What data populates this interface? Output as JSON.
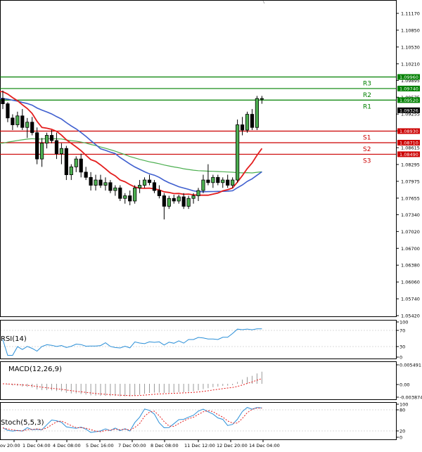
{
  "chart_data": {
    "type": "candlestick",
    "price_axis": {
      "ticks": [
        "1.11170",
        "1.10850",
        "1.10530",
        "1.10210",
        "1.09895",
        "1.09575",
        "1.09255",
        "1.08935",
        "1.08615",
        "1.08295",
        "1.07975",
        "1.07655",
        "1.07340",
        "1.07020",
        "1.06700",
        "1.06380",
        "1.06060",
        "1.05740",
        "1.05420"
      ],
      "range": [
        1.0527,
        1.1135
      ]
    },
    "time_axis": {
      "ticks": [
        "ov 20:00",
        "1 Dec 04:00",
        "4 Dec 08:00",
        "5 Dec 16:00",
        "7 Dec 00:00",
        "8 Dec 08:00",
        "11 Dec 12:00",
        "12 Dec 20:00",
        "14 Dec 04:00"
      ]
    },
    "current_price": "1.09326",
    "levels": [
      {
        "name": "R3",
        "value": 1.0996,
        "label": "1.09960",
        "color": "#008000"
      },
      {
        "name": "R2",
        "value": 1.0974,
        "label": "1.09740",
        "color": "#008000"
      },
      {
        "name": "R1",
        "value": 1.0952,
        "label": "1.09520",
        "color": "#008000"
      },
      {
        "name": "S1",
        "value": 1.0893,
        "label": "1.08930",
        "color": "#cc0000"
      },
      {
        "name": "S2",
        "value": 1.0871,
        "label": "1.08710",
        "color": "#cc0000"
      },
      {
        "name": "S3",
        "value": 1.0849,
        "label": "1.08490",
        "color": "#cc0000"
      }
    ],
    "candles": [
      [
        1.0955,
        1.097,
        1.0935,
        1.0945
      ],
      [
        1.0945,
        1.0948,
        1.091,
        1.0918
      ],
      [
        1.0918,
        1.0925,
        1.0895,
        1.0905
      ],
      [
        1.0905,
        1.093,
        1.09,
        1.0922
      ],
      [
        1.0922,
        1.0935,
        1.0895,
        1.09
      ],
      [
        1.09,
        1.0918,
        1.088,
        1.091
      ],
      [
        1.091,
        1.092,
        1.0885,
        1.089
      ],
      [
        1.089,
        1.09,
        1.083,
        1.084
      ],
      [
        1.084,
        1.088,
        1.0825,
        1.087
      ],
      [
        1.087,
        1.089,
        1.086,
        1.0885
      ],
      [
        1.0885,
        1.0895,
        1.087,
        1.0875
      ],
      [
        1.0875,
        1.089,
        1.084,
        1.085
      ],
      [
        1.085,
        1.087,
        1.083,
        1.086
      ],
      [
        1.086,
        1.0865,
        1.08,
        1.081
      ],
      [
        1.081,
        1.083,
        1.08,
        1.0825
      ],
      [
        1.0825,
        1.0845,
        1.0815,
        1.084
      ],
      [
        1.084,
        1.085,
        1.0805,
        1.0815
      ],
      [
        1.0815,
        1.0825,
        1.08,
        1.0805
      ],
      [
        1.0805,
        1.0815,
        1.078,
        1.079
      ],
      [
        1.079,
        1.081,
        1.078,
        1.08
      ],
      [
        1.08,
        1.081,
        1.0785,
        1.079
      ],
      [
        1.079,
        1.0805,
        1.078,
        1.0795
      ],
      [
        1.0795,
        1.08,
        1.0775,
        1.078
      ],
      [
        1.078,
        1.079,
        1.077,
        1.0785
      ],
      [
        1.0785,
        1.079,
        1.076,
        1.0765
      ],
      [
        1.0765,
        1.0775,
        1.0755,
        1.077
      ],
      [
        1.077,
        1.078,
        1.0752,
        1.076
      ],
      [
        1.076,
        1.079,
        1.0755,
        1.0785
      ],
      [
        1.0785,
        1.08,
        1.0775,
        1.079
      ],
      [
        1.079,
        1.0805,
        1.0785,
        1.08
      ],
      [
        1.08,
        1.081,
        1.079,
        1.0795
      ],
      [
        1.0795,
        1.08,
        1.0775,
        1.078
      ],
      [
        1.078,
        1.079,
        1.0765,
        1.077
      ],
      [
        1.077,
        1.0775,
        1.0725,
        1.075
      ],
      [
        1.075,
        1.077,
        1.0745,
        1.0765
      ],
      [
        1.0765,
        1.0772,
        1.0755,
        1.076
      ],
      [
        1.076,
        1.0772,
        1.0755,
        1.0768
      ],
      [
        1.0768,
        1.0775,
        1.0745,
        1.075
      ],
      [
        1.075,
        1.077,
        1.0745,
        1.0765
      ],
      [
        1.0765,
        1.0775,
        1.0755,
        1.077
      ],
      [
        1.077,
        1.0785,
        1.076,
        1.078
      ],
      [
        1.078,
        1.081,
        1.0775,
        1.08
      ],
      [
        1.08,
        1.083,
        1.079,
        1.0795
      ],
      [
        1.0795,
        1.081,
        1.0785,
        1.0805
      ],
      [
        1.0805,
        1.081,
        1.079,
        1.0795
      ],
      [
        1.0795,
        1.0805,
        1.0785,
        1.08
      ],
      [
        1.08,
        1.081,
        1.0785,
        1.079
      ],
      [
        1.079,
        1.0805,
        1.0785,
        1.08
      ],
      [
        1.08,
        1.0915,
        1.0795,
        1.0905
      ],
      [
        1.0905,
        1.092,
        1.0885,
        1.0895
      ],
      [
        1.0895,
        1.093,
        1.089,
        1.0925
      ],
      [
        1.0925,
        1.0935,
        1.0895,
        1.09
      ],
      [
        1.09,
        1.096,
        1.0895,
        1.0955
      ],
      [
        1.0955,
        1.096,
        1.0945,
        1.0955
      ]
    ],
    "indicators": [
      {
        "name": "RSI(14)",
        "ticks": [
          "100",
          "70",
          "30",
          "0"
        ],
        "range": [
          0,
          100
        ]
      },
      {
        "name": "MACD(12,26,9)",
        "ticks": [
          "0.005491",
          "0.00",
          "-0.003874"
        ],
        "range": [
          -0.003874,
          0.005491
        ]
      },
      {
        "name": "Stoch(5,5,3)",
        "ticks": [
          "100",
          "80",
          "20",
          "0"
        ],
        "range": [
          0,
          100
        ]
      }
    ]
  }
}
